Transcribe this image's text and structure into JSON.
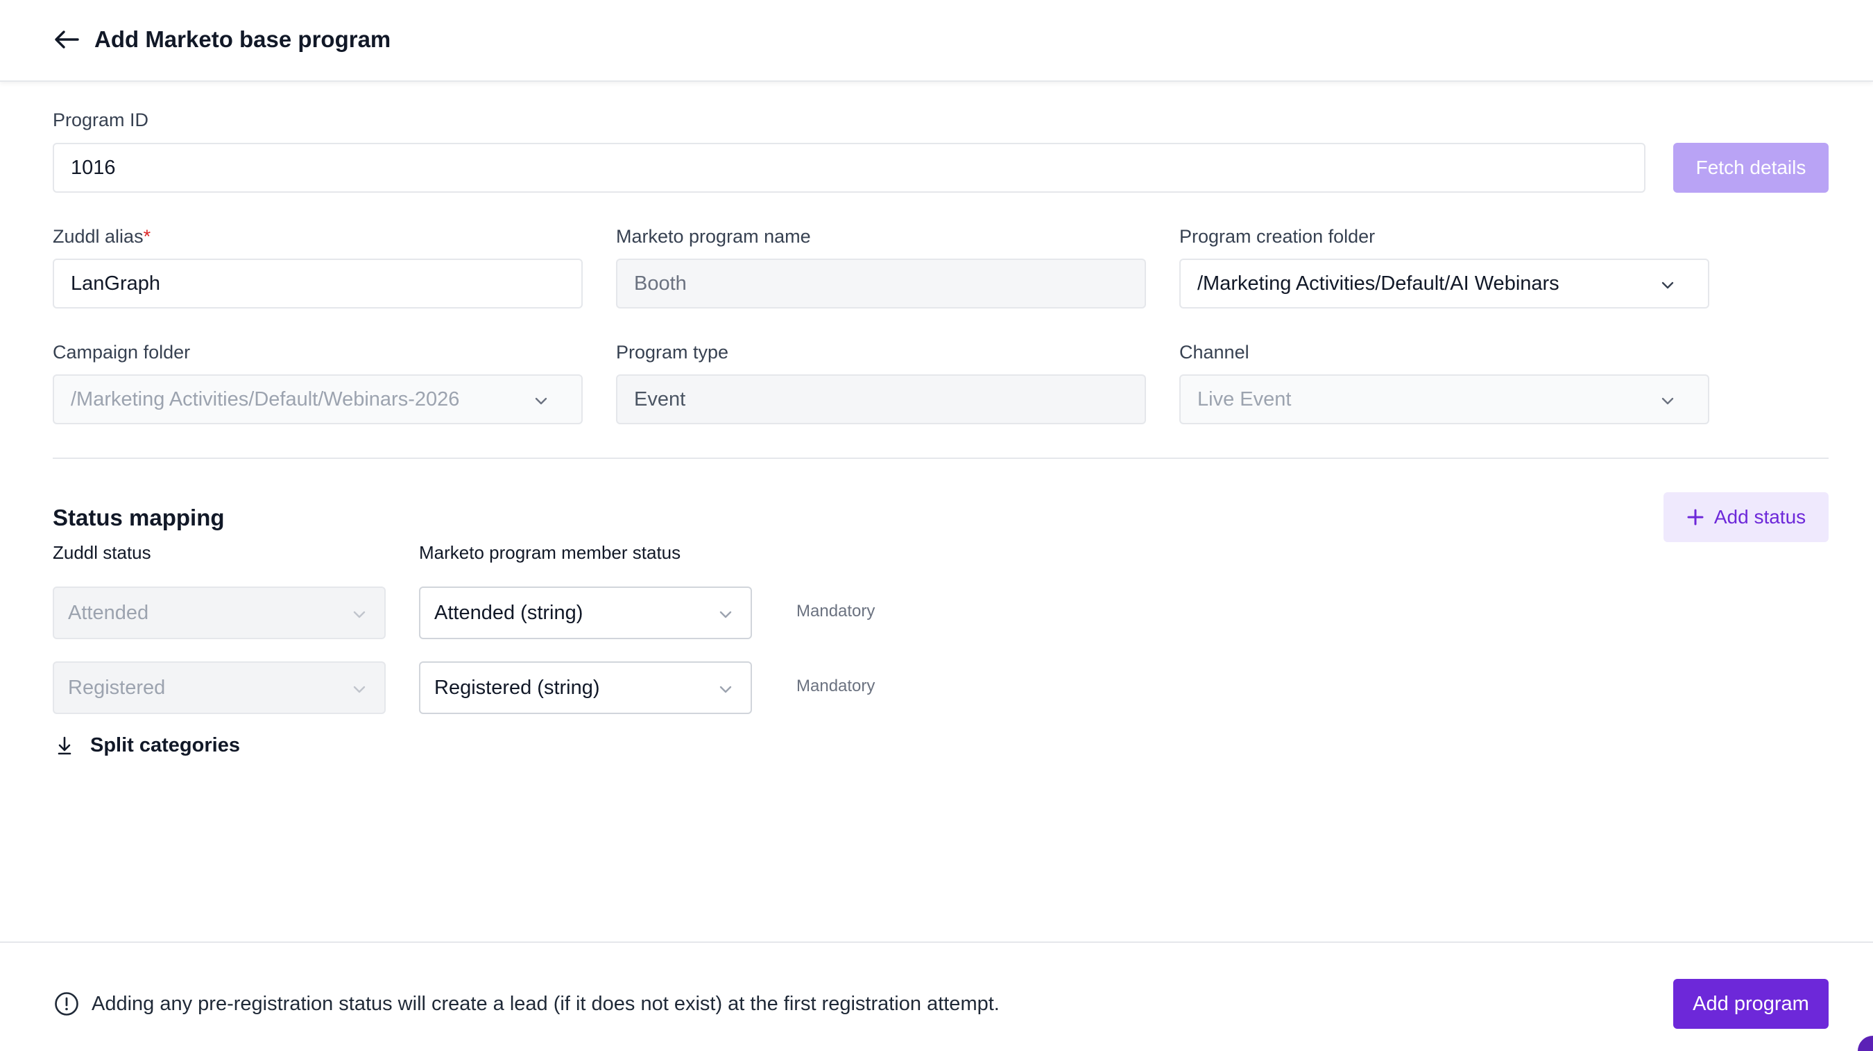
{
  "header": {
    "title": "Add Marketo base program"
  },
  "form": {
    "program_id": {
      "label": "Program ID",
      "value": "1016"
    },
    "fetch_button": "Fetch details",
    "zuddl_alias": {
      "label": "Zuddl alias",
      "required_mark": "*",
      "value": "LanGraph"
    },
    "marketo_program_name": {
      "label": "Marketo program name",
      "value": "Booth"
    },
    "program_creation_folder": {
      "label": "Program creation folder",
      "value": "/Marketing Activities/Default/AI Webinars"
    },
    "campaign_folder": {
      "label": "Campaign folder",
      "value": "/Marketing Activities/Default/Webinars-2026"
    },
    "program_type": {
      "label": "Program type",
      "value": "Event"
    },
    "channel": {
      "label": "Channel",
      "value": "Live Event"
    }
  },
  "status_mapping": {
    "title": "Status mapping",
    "add_status_button": "Add status",
    "col_zuddl": "Zuddl status",
    "col_marketo": "Marketo program member status",
    "rows": [
      {
        "zuddl": "Attended",
        "marketo": "Attended (string)",
        "note": "Mandatory"
      },
      {
        "zuddl": "Registered",
        "marketo": "Registered (string)",
        "note": "Mandatory"
      }
    ],
    "split_label": "Split categories"
  },
  "footer": {
    "info_text": "Adding any pre-registration status will create a lead (if it does not exist) at the first registration attempt.",
    "add_program_button": "Add program"
  },
  "colors": {
    "accent": "#6d28d9",
    "accent_light": "#efe9fd",
    "fetch_disabled": "#b9a3f5",
    "required": "#dc2626"
  },
  "icons": [
    "arrow-left-icon",
    "chevron-down-icon",
    "plus-icon",
    "split-down-icon",
    "info-icon"
  ]
}
